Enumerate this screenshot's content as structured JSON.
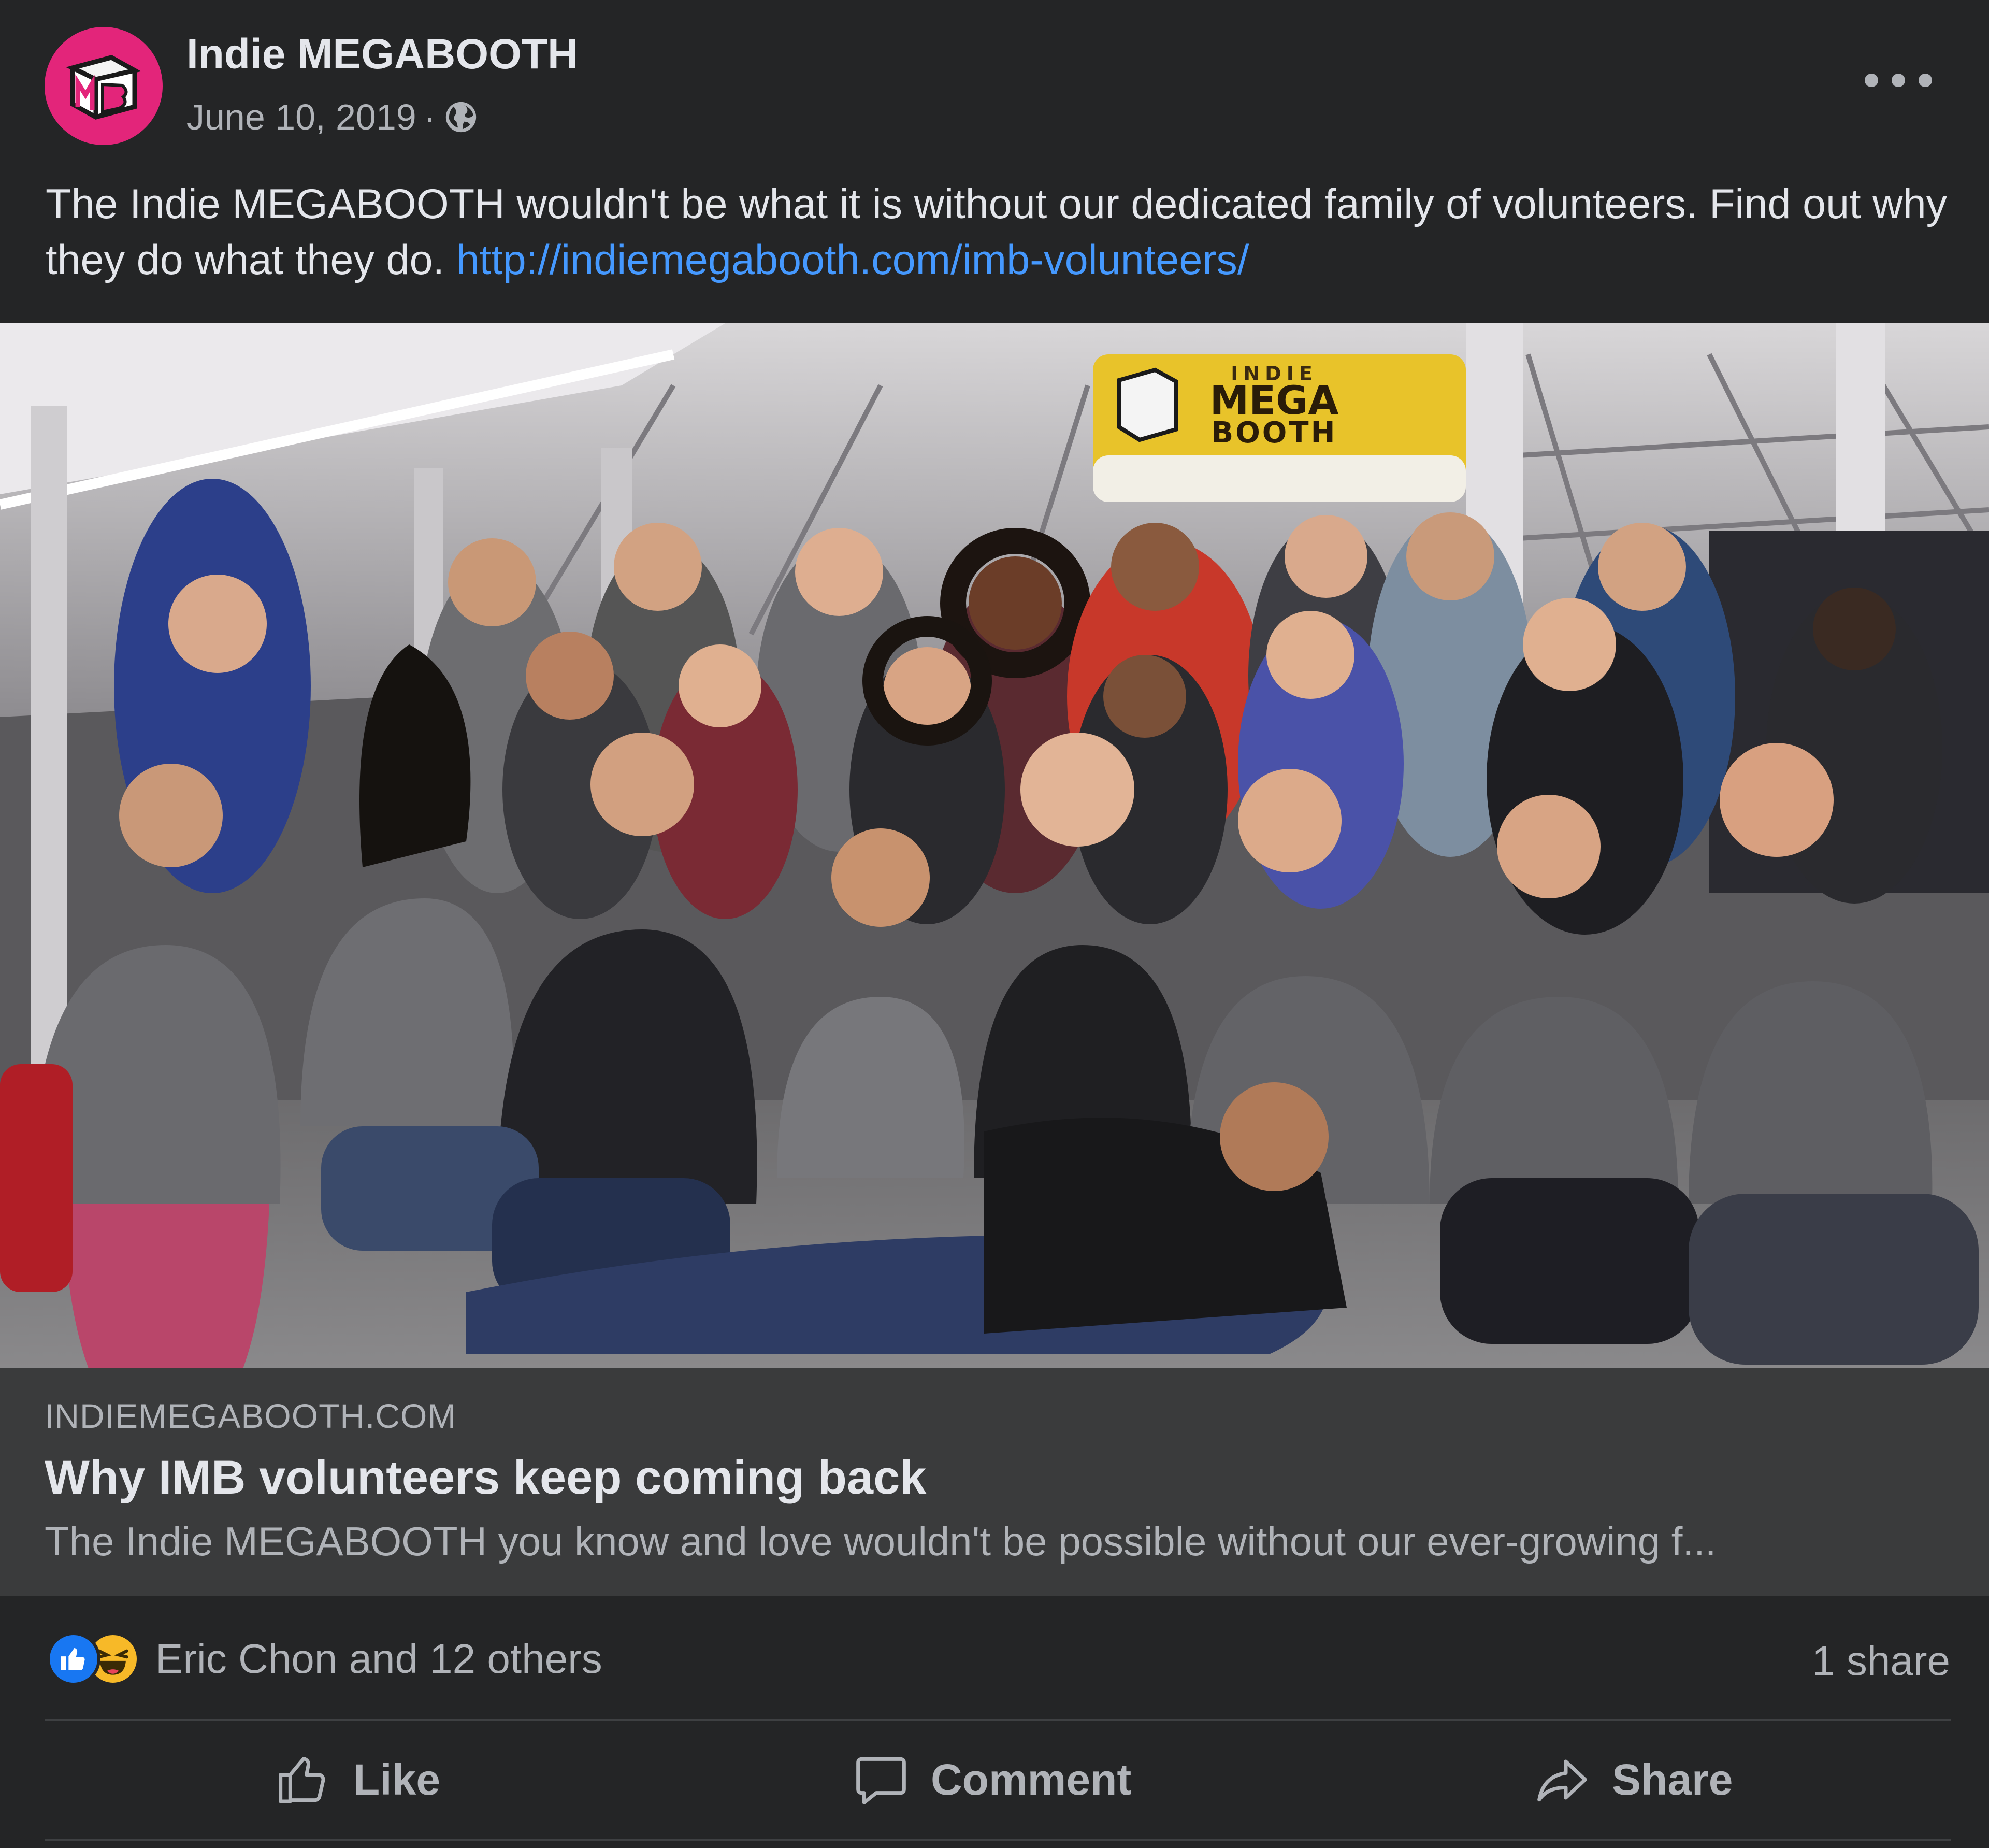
{
  "post": {
    "page_name": "Indie MEGABOOTH",
    "avatar_letters": "MB",
    "date": "June 10, 2019",
    "separator": "·",
    "visibility_icon": "globe-icon",
    "more_icon": "more-options-icon",
    "text": "The Indie MEGABOOTH wouldn't be what it is without our dedicated family of volunteers. Find out why they do what they do.",
    "link": "http://indiemegabooth.com/imb-volunteers/"
  },
  "photo": {
    "banner_line1": "INDIE",
    "banner_line2": "MEGA",
    "banner_line3": "BOOTH"
  },
  "preview": {
    "domain": "INDIEMEGABOOTH.COM",
    "title": "Why IMB volunteers keep coming back",
    "description": "The Indie MEGABOOTH you know and love wouldn't be possible without our ever-growing f..."
  },
  "engagement": {
    "reaction_icons": [
      "like-reaction-icon",
      "haha-reaction-icon"
    ],
    "reactions_text": "Eric Chon and 12 others",
    "shares_text": "1 share"
  },
  "actions": {
    "like_label": "Like",
    "comment_label": "Comment",
    "share_label": "Share"
  },
  "colors": {
    "background": "#242526",
    "preview_background": "#3a3b3c",
    "link": "#4599ff",
    "avatar": "#e3257a",
    "like_blue": "#1877f2",
    "haha_yellow": "#f7b928",
    "banner_yellow": "#e8c32a"
  }
}
